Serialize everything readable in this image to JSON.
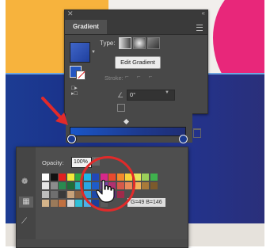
{
  "panel": {
    "title": "Gradient",
    "type_label": "Type:",
    "edit_button": "Edit Gradient",
    "stroke_label": "Stroke:",
    "angle_value": "0°"
  },
  "swatches_popup": {
    "opacity_label": "Opacity:",
    "opacity_value": "100%",
    "hint_text": "G=49 B=146",
    "rows": [
      [
        "#ffffff",
        "#111111",
        "#e02020",
        "#f6e93a",
        "#2fa844",
        "#1fb8e6",
        "#2248b8",
        "#d6288a",
        "#e84a2e",
        "#f38a2c",
        "#f7d33a",
        "#e5e75a",
        "#9bd05a",
        "#3fb14d"
      ],
      [
        "#e4e4e4",
        "#8c8c8c",
        "#2a8a50",
        "#1f6e3a",
        "#2bb5c2",
        "#2aa6e4",
        "#1f5cc8",
        "#7842a8",
        "#b03070",
        "#d65a4a",
        "#e98a5a",
        "#f1b25a",
        "#a87a3a",
        "#7c5a2c"
      ],
      [
        "#bdbdbd",
        "#6f6f6f",
        "#3a3a3a",
        "#c8a27a",
        "#8a6242",
        "#36a0d8",
        "#1f49a8",
        "#2b2f78",
        "#5b2a80",
        "#a02a4a"
      ],
      [
        "#d4b48a",
        "#9a7a5a",
        "#c07040",
        "#d8d8d8",
        "#2ec0d8",
        "#4fb0e8",
        "#1d3f9a",
        "#5a5a5a"
      ]
    ]
  },
  "icons": {
    "panel_close": "close-icon",
    "panel_collapse": "collapse-icon",
    "panel_menu": "menu-icon",
    "pointer": "hand-pointer-icon",
    "annotation_arrow": "red-arrow-icon"
  },
  "colors": {
    "artwork_orange": "#f7b33d",
    "artwork_pink": "#e8277a",
    "artwork_navy": "#1c3c93",
    "annotation_red": "#e12a2a",
    "panel_bg": "#484848"
  }
}
